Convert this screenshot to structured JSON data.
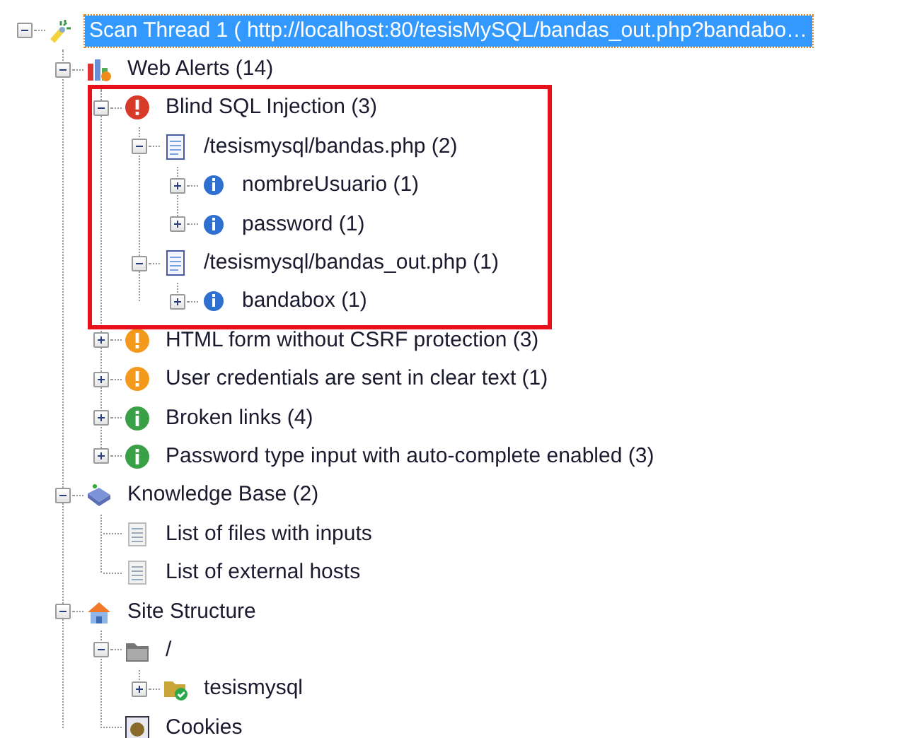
{
  "tree": [
    {
      "label": "Scan Thread 1 ( http://localhost:80/tesisMySQL/bandas_out.php?bandabo…",
      "kind": "scan",
      "expanded": true,
      "selected": true,
      "children": [
        {
          "label": "Web Alerts (14)",
          "kind": "alerts",
          "expanded": true,
          "selected": false,
          "children": [
            {
              "label": "Blind SQL Injection (3)",
              "kind": "alert-high",
              "expanded": true,
              "selected": false,
              "framed": true,
              "children": [
                {
                  "label": "/tesismysql/bandas.php (2)",
                  "kind": "page",
                  "expanded": true,
                  "selected": false,
                  "children": [
                    {
                      "label": "nombreUsuario (1)",
                      "kind": "info",
                      "expanded": false,
                      "selected": false
                    },
                    {
                      "label": "password (1)",
                      "kind": "info",
                      "expanded": false,
                      "selected": false
                    }
                  ]
                },
                {
                  "label": "/tesismysql/bandas_out.php (1)",
                  "kind": "page",
                  "expanded": true,
                  "selected": false,
                  "children": [
                    {
                      "label": "bandabox (1)",
                      "kind": "info",
                      "expanded": false,
                      "selected": false
                    }
                  ]
                }
              ]
            },
            {
              "label": "HTML form without CSRF protection (3)",
              "kind": "alert-medium",
              "expanded": false,
              "selected": false
            },
            {
              "label": "User credentials are sent in clear text (1)",
              "kind": "alert-medium",
              "expanded": false,
              "selected": false
            },
            {
              "label": "Broken links (4)",
              "kind": "alert-low",
              "expanded": false,
              "selected": false
            },
            {
              "label": "Password type input with auto-complete enabled (3)",
              "kind": "alert-low",
              "expanded": false,
              "selected": false
            }
          ]
        },
        {
          "label": "Knowledge Base (2)",
          "kind": "knowledge",
          "expanded": true,
          "selected": false,
          "children": [
            {
              "label": "List of files with inputs",
              "kind": "list",
              "selected": false
            },
            {
              "label": "List of external hosts",
              "kind": "list",
              "selected": false
            }
          ]
        },
        {
          "label": "Site Structure",
          "kind": "site",
          "expanded": true,
          "selected": false,
          "children": [
            {
              "label": "/",
              "kind": "folder",
              "expanded": true,
              "selected": false,
              "children": [
                {
                  "label": "tesismysql",
                  "kind": "folder-ok",
                  "expanded": false,
                  "selected": false
                }
              ]
            },
            {
              "label": "Cookies",
              "kind": "cookie",
              "selected": false
            }
          ]
        }
      ]
    }
  ]
}
